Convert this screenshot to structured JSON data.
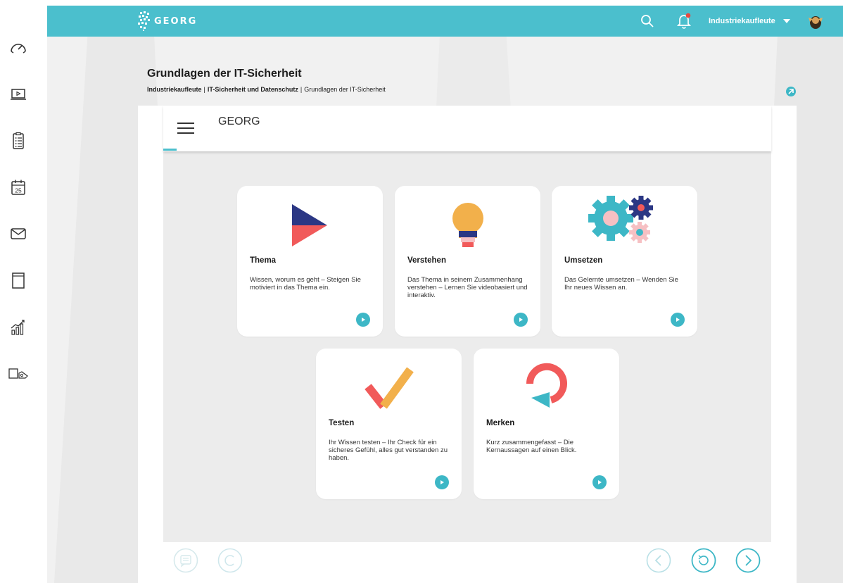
{
  "colors": {
    "accent": "#4bbfcd",
    "play": "#3db7c6",
    "navy": "#2b3784",
    "coral": "#f15a5a",
    "amber": "#f2b04b",
    "pink": "#f6c0c3"
  },
  "rail": {
    "icons": [
      "dashboard-icon",
      "video-icon",
      "checklist-icon",
      "calendar-icon",
      "mail-icon",
      "book-icon",
      "statistics-icon",
      "notes-icon"
    ],
    "calendar_day": "25"
  },
  "header": {
    "brand": "GEORG",
    "course_select": "Industriekaufleute",
    "search_icon": "search-icon",
    "bell_icon": "bell-icon",
    "avatar_icon": "avatar-icon"
  },
  "page": {
    "title": "Grundlagen der IT-Sicherheit",
    "breadcrumb": [
      "Industriekaufleute",
      "IT-Sicherheit und Datenschutz",
      "Grundlagen der IT-Sicherheit"
    ],
    "breadcrumb_sep": "|"
  },
  "player": {
    "title": "GEORG",
    "cards": [
      {
        "title": "Thema",
        "description": "Wissen, worum es geht – Steigen Sie motiviert in das Thema ein.",
        "icon": "play-triangle-icon"
      },
      {
        "title": "Verstehen",
        "description": "Das Thema in seinem Zusammenhang verstehen – Lernen Sie videobasiert und interaktiv.",
        "icon": "lightbulb-icon"
      },
      {
        "title": "Umsetzen",
        "description": "Das Gelernte umsetzen – Wenden Sie Ihr neues Wissen an.",
        "icon": "gears-icon"
      },
      {
        "title": "Testen",
        "description": "Ihr Wissen testen – Ihr Check für ein sicheres Gefühl, alles gut verstanden zu haben.",
        "icon": "checkmark-icon"
      },
      {
        "title": "Merken",
        "description": "Kurz zusammengefasst – Die Kernaussagen auf einen Blick.",
        "icon": "circular-arrow-icon"
      }
    ],
    "footer": {
      "left": [
        "transcript-icon",
        "copyright-icon"
      ],
      "right": [
        "previous-icon",
        "replay-icon",
        "next-icon"
      ]
    }
  }
}
